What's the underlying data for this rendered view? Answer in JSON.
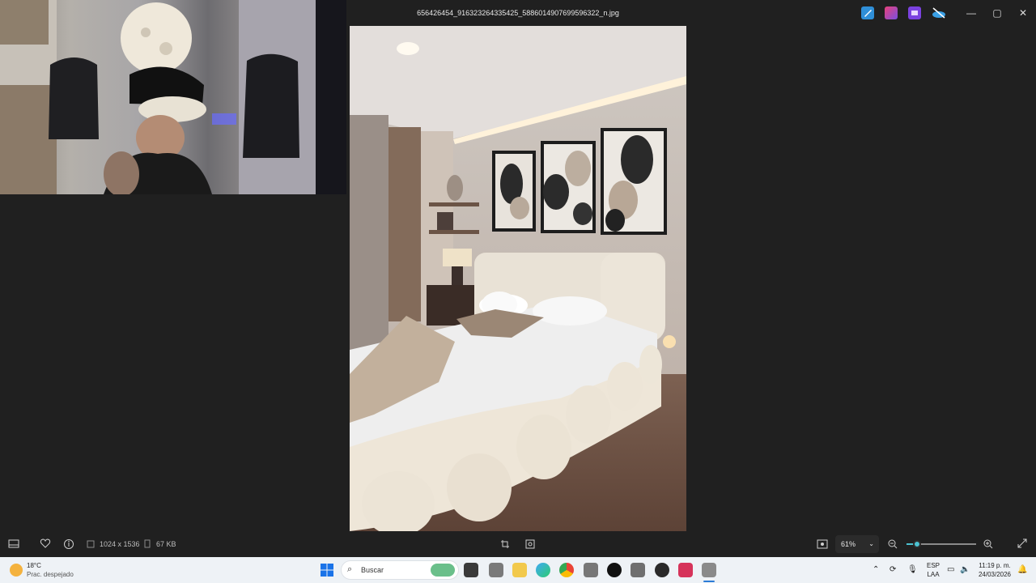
{
  "window": {
    "title": "656426454_916323264335425_5886014907699596322_n.jpg",
    "controls": {
      "minimize": "—",
      "maximize": "▢",
      "close": "✕"
    }
  },
  "toolbar_apps": [
    {
      "name": "draw-icon",
      "color": "#2f8fd8"
    },
    {
      "name": "copilot-icon",
      "color": "#c04fd6"
    },
    {
      "name": "clipchamp-icon",
      "color": "#7b42e0"
    },
    {
      "name": "onedrive-offline-icon",
      "color": "#3aa0e6"
    }
  ],
  "status_bar": {
    "dimensions": "1024 x 1536",
    "file_size": "67 KB",
    "zoom": "61%",
    "zoom_level": 0.15
  },
  "taskbar": {
    "weather_temp": "18°C",
    "weather_desc": "Prac. despejado",
    "search_placeholder": "Buscar",
    "language_top": "ESP",
    "language_bottom": "LAA",
    "time": "11:19 p. m.",
    "date": "24/03/2026"
  },
  "colors": {
    "accent": "#4cc2d1",
    "background": "#202020",
    "taskbar": "#eef2f6"
  }
}
